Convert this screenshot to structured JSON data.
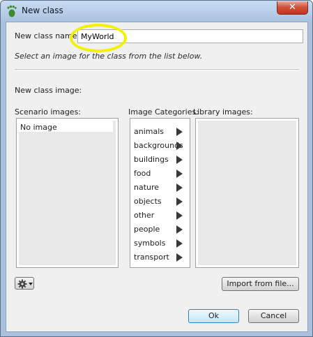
{
  "window": {
    "title": "New class",
    "close_glyph": "✕"
  },
  "form": {
    "name_label": "New class name",
    "name_value": "MyWorld",
    "hint": "Select an image for the class from the list below.",
    "image_label": "New class image:"
  },
  "scenario": {
    "label": "Scenario images:",
    "items": [
      "No image"
    ]
  },
  "categories": {
    "label": "Image Categories:",
    "items": [
      "animals",
      "backgrounds",
      "buildings",
      "food",
      "nature",
      "objects",
      "other",
      "people",
      "symbols",
      "transport"
    ]
  },
  "library": {
    "label": "Library images:"
  },
  "buttons": {
    "import": "Import from file...",
    "ok": "Ok",
    "cancel": "Cancel"
  },
  "icons": {
    "app": "greenfoot-foot-icon",
    "gear": "gear-icon",
    "close": "close-icon",
    "arrow": "triangle-right-icon"
  },
  "colors": {
    "highlight": "#f2f200",
    "title_bar": "#b5cbe6",
    "close": "#c2361e"
  }
}
